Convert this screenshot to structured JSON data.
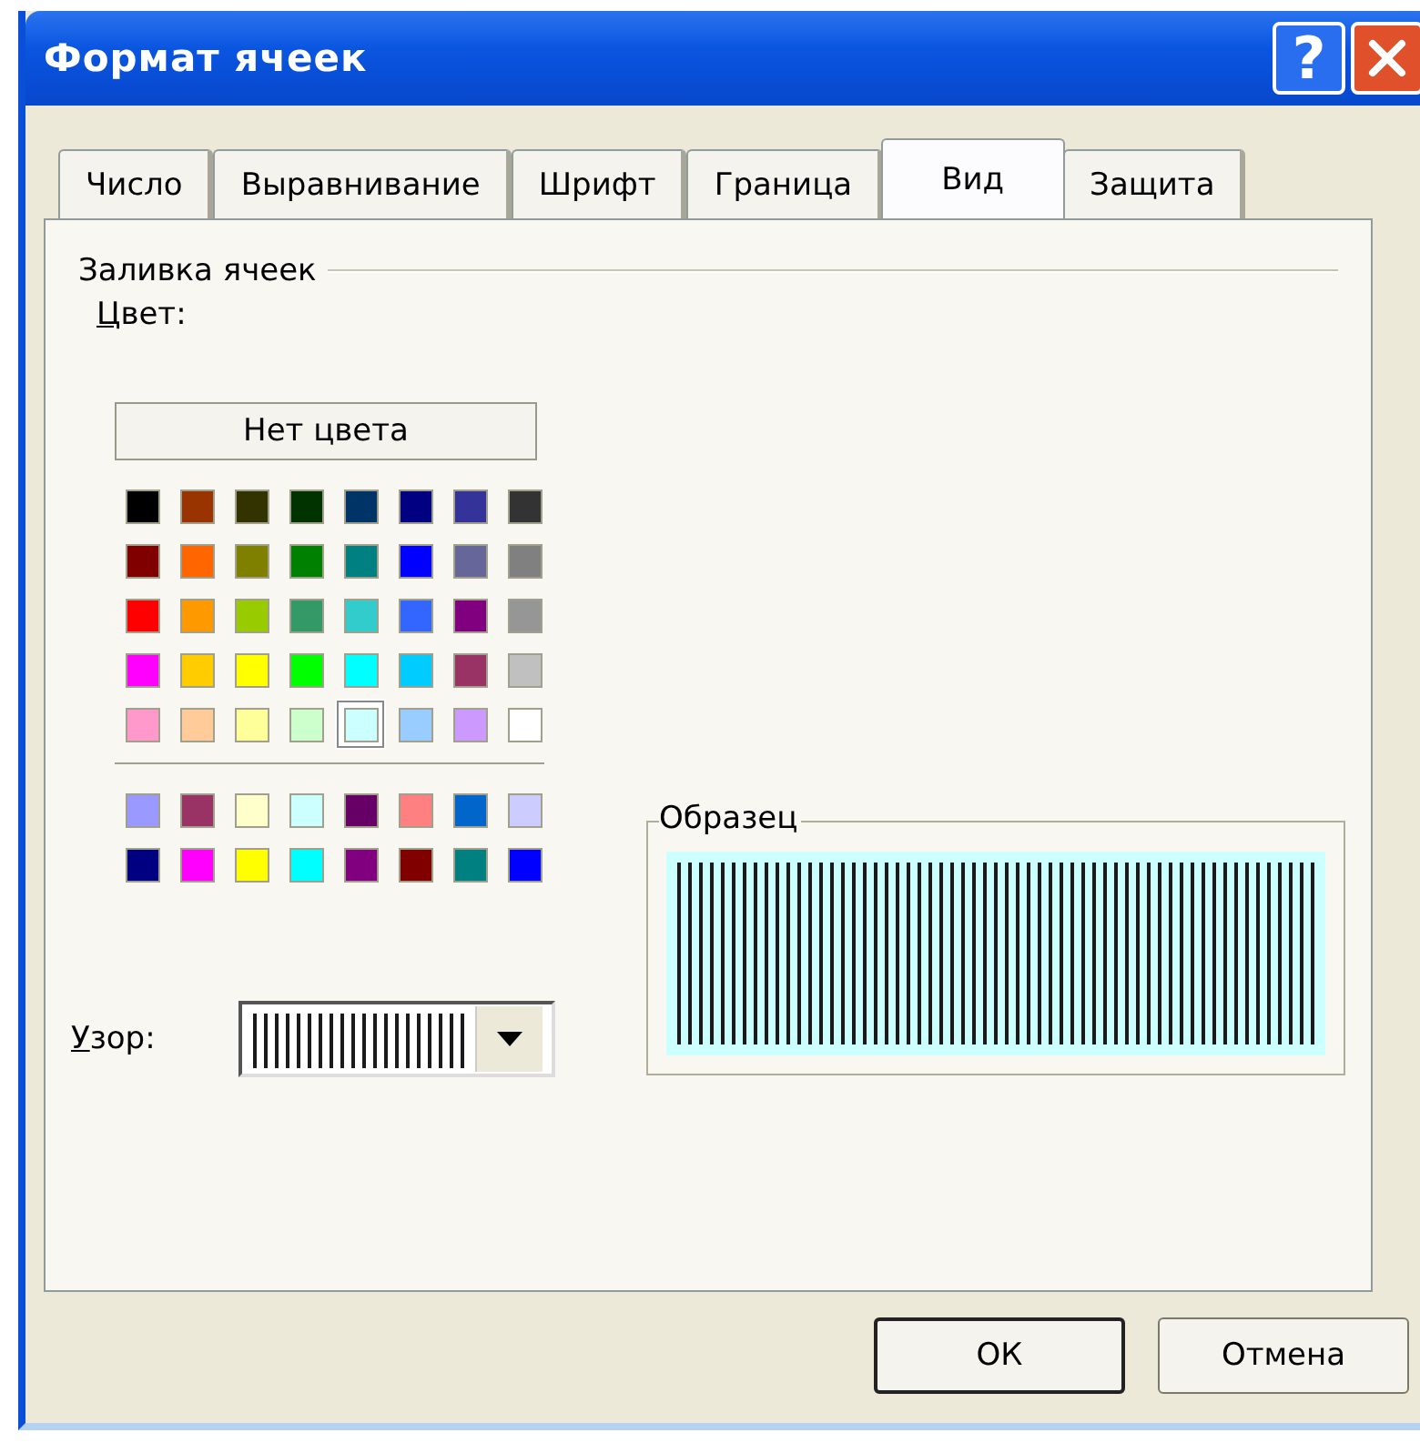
{
  "window": {
    "title": "Формат ячеек",
    "help_button": "?"
  },
  "tabs": [
    {
      "label": "Число",
      "selected": false
    },
    {
      "label": "Выравнивание",
      "selected": false
    },
    {
      "label": "Шрифт",
      "selected": false
    },
    {
      "label": "Граница",
      "selected": false
    },
    {
      "label": "Вид",
      "selected": true
    },
    {
      "label": "Защита",
      "selected": false
    }
  ],
  "fill_group": {
    "title": "Заливка ячеек",
    "color_label": "Цвет:",
    "no_color_button": "Нет цвета",
    "swatches": [
      {
        "color": "#000000",
        "selected": false
      },
      {
        "color": "#993300",
        "selected": false
      },
      {
        "color": "#333300",
        "selected": false
      },
      {
        "color": "#003300",
        "selected": false
      },
      {
        "color": "#003366",
        "selected": false
      },
      {
        "color": "#000080",
        "selected": false
      },
      {
        "color": "#333399",
        "selected": false
      },
      {
        "color": "#333333",
        "selected": false
      },
      {
        "color": "#800000",
        "selected": false
      },
      {
        "color": "#ff6600",
        "selected": false
      },
      {
        "color": "#808000",
        "selected": false
      },
      {
        "color": "#008000",
        "selected": false
      },
      {
        "color": "#008080",
        "selected": false
      },
      {
        "color": "#0000ff",
        "selected": false
      },
      {
        "color": "#666699",
        "selected": false
      },
      {
        "color": "#808080",
        "selected": false
      },
      {
        "color": "#ff0000",
        "selected": false
      },
      {
        "color": "#ff9900",
        "selected": false
      },
      {
        "color": "#99cc00",
        "selected": false
      },
      {
        "color": "#339966",
        "selected": false
      },
      {
        "color": "#33cccc",
        "selected": false
      },
      {
        "color": "#3366ff",
        "selected": false
      },
      {
        "color": "#800080",
        "selected": false
      },
      {
        "color": "#969696",
        "selected": false
      },
      {
        "color": "#ff00ff",
        "selected": false
      },
      {
        "color": "#ffcc00",
        "selected": false
      },
      {
        "color": "#ffff00",
        "selected": false
      },
      {
        "color": "#00ff00",
        "selected": false
      },
      {
        "color": "#00ffff",
        "selected": false
      },
      {
        "color": "#00ccff",
        "selected": false
      },
      {
        "color": "#993366",
        "selected": false
      },
      {
        "color": "#c0c0c0",
        "selected": false
      },
      {
        "color": "#ff99cc",
        "selected": false
      },
      {
        "color": "#ffcc99",
        "selected": false
      },
      {
        "color": "#ffff99",
        "selected": false
      },
      {
        "color": "#ccffcc",
        "selected": false
      },
      {
        "color": "#ccffff",
        "selected": true
      },
      {
        "color": "#99ccff",
        "selected": false
      },
      {
        "color": "#cc99ff",
        "selected": false
      },
      {
        "color": "#ffffff",
        "selected": false
      }
    ],
    "extra_swatches": [
      {
        "color": "#9999ff",
        "selected": false
      },
      {
        "color": "#993366",
        "selected": false
      },
      {
        "color": "#ffffcc",
        "selected": false
      },
      {
        "color": "#ccffff",
        "selected": false
      },
      {
        "color": "#660066",
        "selected": false
      },
      {
        "color": "#ff8080",
        "selected": false
      },
      {
        "color": "#0066cc",
        "selected": false
      },
      {
        "color": "#ccccff",
        "selected": false
      },
      {
        "color": "#000080",
        "selected": false
      },
      {
        "color": "#ff00ff",
        "selected": false
      },
      {
        "color": "#ffff00",
        "selected": false
      },
      {
        "color": "#00ffff",
        "selected": false
      },
      {
        "color": "#800080",
        "selected": false
      },
      {
        "color": "#800000",
        "selected": false
      },
      {
        "color": "#008080",
        "selected": false
      },
      {
        "color": "#0000ff",
        "selected": false
      }
    ],
    "pattern_label": "Узор:",
    "pattern": {
      "kind": "vertical_stripes"
    }
  },
  "sample": {
    "title": "Образец"
  },
  "buttons": [
    {
      "label": "ОК",
      "default": true
    },
    {
      "label": "Отмена",
      "default": false
    }
  ]
}
